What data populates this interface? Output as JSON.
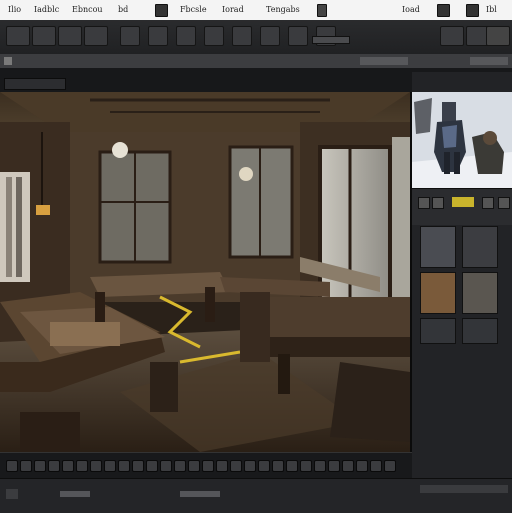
{
  "menubar": {
    "items": [
      "Ilio",
      "Iadblc",
      "Ebncou",
      "bd",
      "Fbcsle",
      "Iorad",
      "Tengabs",
      "Ioad",
      "Ibl"
    ]
  },
  "toolbar": {
    "tool_count": 20
  },
  "viewport": {
    "scene": "workshop-interior-render"
  },
  "right_panel": {
    "thumbnail_count": 6
  },
  "timeline": {
    "button_count": 28
  },
  "colors": {
    "menubar_bg": "#f4f4f4",
    "chrome_dark": "#1b1c1e",
    "accent_yellow": "#e0c230"
  }
}
